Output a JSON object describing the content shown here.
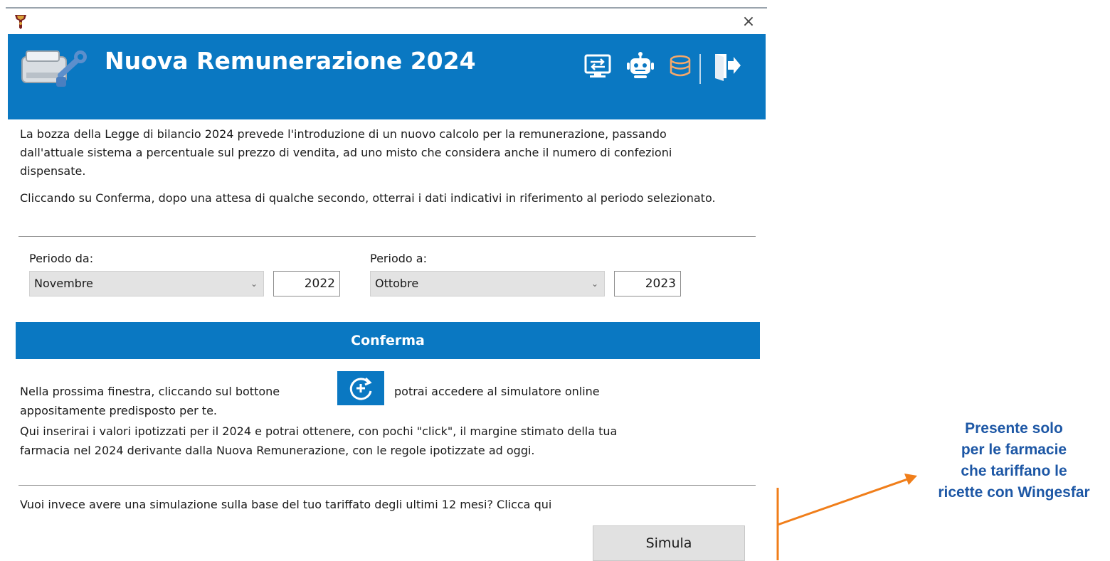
{
  "window": {
    "close_glyph": "×",
    "app_icon": "app-logo-icon"
  },
  "header": {
    "title": "Nuova Remunerazione 2024",
    "icons": [
      "remote-desktop-icon",
      "robot-icon",
      "database-icon",
      "exit-door-icon"
    ]
  },
  "intro": {
    "paragraph1": "La bozza della Legge di bilancio 2024 prevede l'introduzione di un nuovo calcolo per la remunerazione, passando dall'attuale sistema a percentuale sul prezzo di vendita, ad uno misto che considera anche il numero di confezioni dispensate.",
    "paragraph2": "Cliccando su Conferma, dopo una attesa di qualche secondo, otterrai i dati indicativi in riferimento al periodo selezionato."
  },
  "period": {
    "from_label": "Periodo da:",
    "from_month": "Novembre",
    "from_year": "2022",
    "to_label": "Periodo a:",
    "to_month": "Ottobre",
    "to_year": "2023"
  },
  "confirm_label": "Conferma",
  "next_window": {
    "text_before": "Nella prossima finestra, cliccando sul bottone",
    "text_after": "potrai accedere al simulatore online",
    "line2": "appositamente predisposto per te.",
    "line3": "Qui inserirai i valori ipotizzati per il 2024 e potrai ottenere, con pochi \"click\", il margine stimato della tua",
    "line4": "farmacia nel 2024 derivante dalla Nuova Remunerazione, con le regole ipotizzate ad oggi.",
    "button_icon": "refresh-plus-icon"
  },
  "simulation": {
    "question": "Vuoi invece avere una simulazione sulla base del tuo tariffato degli ultimi 12 mesi? Clicca qui",
    "button_label": "Simula"
  },
  "annotation": {
    "lines": [
      "Presente solo",
      "per le farmacie",
      "che tariffano le",
      "ricette con Wingesfar"
    ],
    "color": "#1d57a5",
    "arrow_color": "#f07e1a"
  },
  "colors": {
    "accent": "#0a78c2"
  }
}
